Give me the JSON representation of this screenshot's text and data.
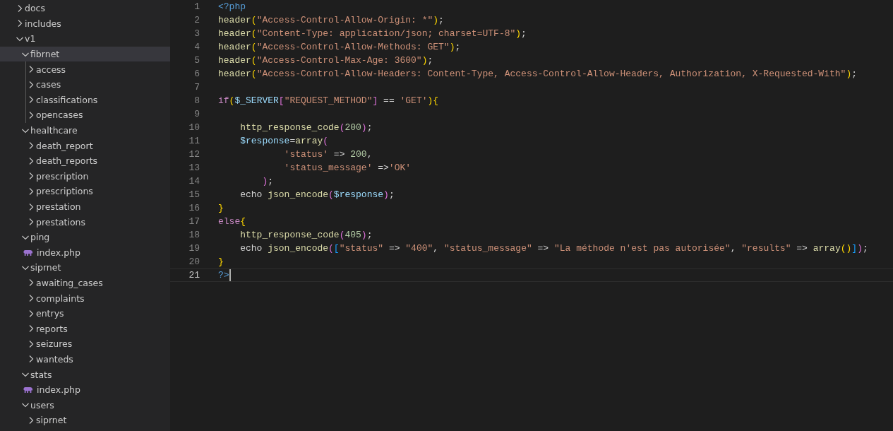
{
  "explorer": {
    "tree": [
      {
        "label": "docs",
        "kind": "folder",
        "expanded": false,
        "selected": false
      },
      {
        "label": "includes",
        "kind": "folder",
        "expanded": false,
        "selected": false
      },
      {
        "label": "v1",
        "kind": "folder",
        "expanded": true,
        "selected": false,
        "children": [
          {
            "label": "fibrnet",
            "kind": "folder",
            "expanded": true,
            "selected": true,
            "children": [
              {
                "label": "access",
                "kind": "folder",
                "expanded": false,
                "selected": false
              },
              {
                "label": "cases",
                "kind": "folder",
                "expanded": false,
                "selected": false
              },
              {
                "label": "classifications",
                "kind": "folder",
                "expanded": false,
                "selected": false
              },
              {
                "label": "opencases",
                "kind": "folder",
                "expanded": false,
                "selected": false
              }
            ]
          },
          {
            "label": "healthcare",
            "kind": "folder",
            "expanded": true,
            "selected": false,
            "children": [
              {
                "label": "death_report",
                "kind": "folder",
                "expanded": false,
                "selected": false
              },
              {
                "label": "death_reports",
                "kind": "folder",
                "expanded": false,
                "selected": false
              },
              {
                "label": "prescription",
                "kind": "folder",
                "expanded": false,
                "selected": false
              },
              {
                "label": "prescriptions",
                "kind": "folder",
                "expanded": false,
                "selected": false
              },
              {
                "label": "prestation",
                "kind": "folder",
                "expanded": false,
                "selected": false
              },
              {
                "label": "prestations",
                "kind": "folder",
                "expanded": false,
                "selected": false
              }
            ]
          },
          {
            "label": "ping",
            "kind": "folder",
            "expanded": true,
            "selected": false,
            "children": [
              {
                "label": "index.php",
                "kind": "file",
                "selected": false
              }
            ]
          },
          {
            "label": "siprnet",
            "kind": "folder",
            "expanded": true,
            "selected": false,
            "children": [
              {
                "label": "awaiting_cases",
                "kind": "folder",
                "expanded": false,
                "selected": false
              },
              {
                "label": "complaints",
                "kind": "folder",
                "expanded": false,
                "selected": false
              },
              {
                "label": "entrys",
                "kind": "folder",
                "expanded": false,
                "selected": false
              },
              {
                "label": "reports",
                "kind": "folder",
                "expanded": false,
                "selected": false
              },
              {
                "label": "seizures",
                "kind": "folder",
                "expanded": false,
                "selected": false
              },
              {
                "label": "wanteds",
                "kind": "folder",
                "expanded": false,
                "selected": false
              }
            ]
          },
          {
            "label": "stats",
            "kind": "folder",
            "expanded": true,
            "selected": false,
            "children": [
              {
                "label": "index.php",
                "kind": "file",
                "selected": false
              }
            ]
          },
          {
            "label": "users",
            "kind": "folder",
            "expanded": true,
            "selected": false,
            "children": [
              {
                "label": "siprnet",
                "kind": "folder",
                "expanded": false,
                "selected": false
              }
            ]
          }
        ]
      }
    ]
  },
  "editor": {
    "lines": [
      {
        "number": "1",
        "active": false,
        "tokens": [
          {
            "kind": "php",
            "text": "<?php"
          }
        ]
      },
      {
        "number": "2",
        "active": false,
        "tokens": [
          {
            "kind": "fn",
            "text": "header"
          },
          {
            "kind": "b1",
            "text": "("
          },
          {
            "kind": "str",
            "text": "\"Access-Control-Allow-Origin: *\""
          },
          {
            "kind": "b1",
            "text": ")"
          },
          {
            "kind": "plain",
            "text": ";"
          }
        ]
      },
      {
        "number": "3",
        "active": false,
        "tokens": [
          {
            "kind": "fn",
            "text": "header"
          },
          {
            "kind": "b1",
            "text": "("
          },
          {
            "kind": "str",
            "text": "\"Content-Type: application/json; charset=UTF-8\""
          },
          {
            "kind": "b1",
            "text": ")"
          },
          {
            "kind": "plain",
            "text": ";"
          }
        ]
      },
      {
        "number": "4",
        "active": false,
        "tokens": [
          {
            "kind": "fn",
            "text": "header"
          },
          {
            "kind": "b1",
            "text": "("
          },
          {
            "kind": "str",
            "text": "\"Access-Control-Allow-Methods: GET\""
          },
          {
            "kind": "b1",
            "text": ")"
          },
          {
            "kind": "plain",
            "text": ";"
          }
        ]
      },
      {
        "number": "5",
        "active": false,
        "tokens": [
          {
            "kind": "fn",
            "text": "header"
          },
          {
            "kind": "b1",
            "text": "("
          },
          {
            "kind": "str",
            "text": "\"Access-Control-Max-Age: 3600\""
          },
          {
            "kind": "b1",
            "text": ")"
          },
          {
            "kind": "plain",
            "text": ";"
          }
        ]
      },
      {
        "number": "6",
        "active": false,
        "tokens": [
          {
            "kind": "fn",
            "text": "header"
          },
          {
            "kind": "b1",
            "text": "("
          },
          {
            "kind": "str",
            "text": "\"Access-Control-Allow-Headers: Content-Type, Access-Control-Allow-Headers, Authorization, X-Requested-With\""
          },
          {
            "kind": "b1",
            "text": ")"
          },
          {
            "kind": "plain",
            "text": ";"
          }
        ]
      },
      {
        "number": "7",
        "active": false
      },
      {
        "number": "8",
        "active": false,
        "tokens": [
          {
            "kind": "kw",
            "text": "if"
          },
          {
            "kind": "b1",
            "text": "("
          },
          {
            "kind": "var",
            "text": "$_SERVER"
          },
          {
            "kind": "b2",
            "text": "["
          },
          {
            "kind": "str",
            "text": "\"REQUEST_METHOD\""
          },
          {
            "kind": "b2",
            "text": "]"
          },
          {
            "kind": "plain",
            "text": " == "
          },
          {
            "kind": "str",
            "text": "'GET'"
          },
          {
            "kind": "b1",
            "text": ")"
          },
          {
            "kind": "b1",
            "text": "{"
          }
        ]
      },
      {
        "number": "9",
        "active": false
      },
      {
        "number": "10",
        "active": false,
        "tokens": [
          {
            "kind": "fn",
            "text": "    http_response_code"
          },
          {
            "kind": "b2",
            "text": "("
          },
          {
            "kind": "num",
            "text": "200"
          },
          {
            "kind": "b2",
            "text": ")"
          },
          {
            "kind": "plain",
            "text": ";"
          }
        ]
      },
      {
        "number": "11",
        "active": false,
        "tokens": [
          {
            "kind": "var",
            "text": "    $response"
          },
          {
            "kind": "plain",
            "text": "="
          },
          {
            "kind": "fn",
            "text": "array"
          },
          {
            "kind": "b2",
            "text": "("
          }
        ]
      },
      {
        "number": "12",
        "active": false,
        "tokens": [
          {
            "kind": "str",
            "text": "            'status'"
          },
          {
            "kind": "plain",
            "text": " => "
          },
          {
            "kind": "num",
            "text": "200"
          },
          {
            "kind": "plain",
            "text": ","
          }
        ]
      },
      {
        "number": "13",
        "active": false,
        "tokens": [
          {
            "kind": "str",
            "text": "            'status_message'"
          },
          {
            "kind": "plain",
            "text": " =>"
          },
          {
            "kind": "str",
            "text": "'OK'"
          }
        ]
      },
      {
        "number": "14",
        "active": false,
        "tokens": [
          {
            "kind": "b2",
            "text": "        )"
          },
          {
            "kind": "plain",
            "text": ";"
          }
        ]
      },
      {
        "number": "15",
        "active": false,
        "tokens": [
          {
            "kind": "plain",
            "text": "    echo "
          },
          {
            "kind": "fn",
            "text": "json_encode"
          },
          {
            "kind": "b2",
            "text": "("
          },
          {
            "kind": "var",
            "text": "$response"
          },
          {
            "kind": "b2",
            "text": ")"
          },
          {
            "kind": "plain",
            "text": ";"
          }
        ]
      },
      {
        "number": "16",
        "active": false,
        "tokens": [
          {
            "kind": "b1",
            "text": "}"
          }
        ]
      },
      {
        "number": "17",
        "active": false,
        "tokens": [
          {
            "kind": "kw",
            "text": "else"
          },
          {
            "kind": "b1",
            "text": "{"
          }
        ]
      },
      {
        "number": "18",
        "active": false,
        "tokens": [
          {
            "kind": "fn",
            "text": "    http_response_code"
          },
          {
            "kind": "b2",
            "text": "("
          },
          {
            "kind": "num",
            "text": "405"
          },
          {
            "kind": "b2",
            "text": ")"
          },
          {
            "kind": "plain",
            "text": ";"
          }
        ]
      },
      {
        "number": "19",
        "active": false,
        "tokens": [
          {
            "kind": "plain",
            "text": "    echo "
          },
          {
            "kind": "fn",
            "text": "json_encode"
          },
          {
            "kind": "b2",
            "text": "("
          },
          {
            "kind": "b3",
            "text": "["
          },
          {
            "kind": "str",
            "text": "\"status\""
          },
          {
            "kind": "plain",
            "text": " => "
          },
          {
            "kind": "str",
            "text": "\"400\""
          },
          {
            "kind": "plain",
            "text": ", "
          },
          {
            "kind": "str",
            "text": "\"status_message\""
          },
          {
            "kind": "plain",
            "text": " => "
          },
          {
            "kind": "str",
            "text": "\"La méthode n'est pas autorisée\""
          },
          {
            "kind": "plain",
            "text": ", "
          },
          {
            "kind": "str",
            "text": "\"results\""
          },
          {
            "kind": "plain",
            "text": " => "
          },
          {
            "kind": "fn",
            "text": "array"
          },
          {
            "kind": "b1",
            "text": "("
          },
          {
            "kind": "b1",
            "text": ")"
          },
          {
            "kind": "b3",
            "text": "]"
          },
          {
            "kind": "b2",
            "text": ")"
          },
          {
            "kind": "plain",
            "text": ";"
          }
        ]
      },
      {
        "number": "20",
        "active": false,
        "tokens": [
          {
            "kind": "b1",
            "text": "}"
          }
        ]
      },
      {
        "number": "21",
        "active": true,
        "tokens": [
          {
            "kind": "php",
            "text": "?>"
          }
        ]
      }
    ]
  }
}
